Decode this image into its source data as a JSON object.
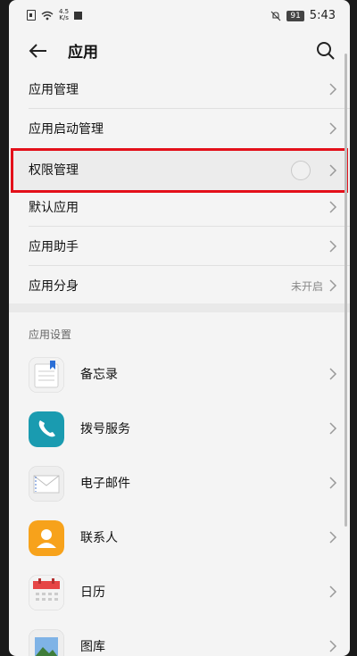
{
  "status_bar": {
    "net_speed_top": "4.5",
    "net_speed_bottom": "K/s",
    "battery": "91",
    "time": "5:43"
  },
  "header": {
    "title": "应用",
    "back_icon": "back-arrow-icon",
    "search_icon": "search-icon"
  },
  "menu": {
    "items": [
      {
        "label": "应用管理"
      },
      {
        "label": "应用启动管理"
      },
      {
        "label": "权限管理"
      },
      {
        "label": "默认应用"
      },
      {
        "label": "应用助手"
      },
      {
        "label": "应用分身",
        "status": "未开启"
      }
    ]
  },
  "app_settings": {
    "section_title": "应用设置",
    "apps": [
      {
        "label": "备忘录",
        "icon": "notes-icon"
      },
      {
        "label": "拨号服务",
        "icon": "phone-icon"
      },
      {
        "label": "电子邮件",
        "icon": "email-icon"
      },
      {
        "label": "联系人",
        "icon": "contacts-icon"
      },
      {
        "label": "日历",
        "icon": "calendar-icon"
      },
      {
        "label": "图库",
        "icon": "gallery-icon"
      }
    ]
  },
  "colors": {
    "highlight_border": "#e3101a",
    "phone_teal": "#1a9bb0",
    "contacts_orange": "#f7a21b"
  }
}
